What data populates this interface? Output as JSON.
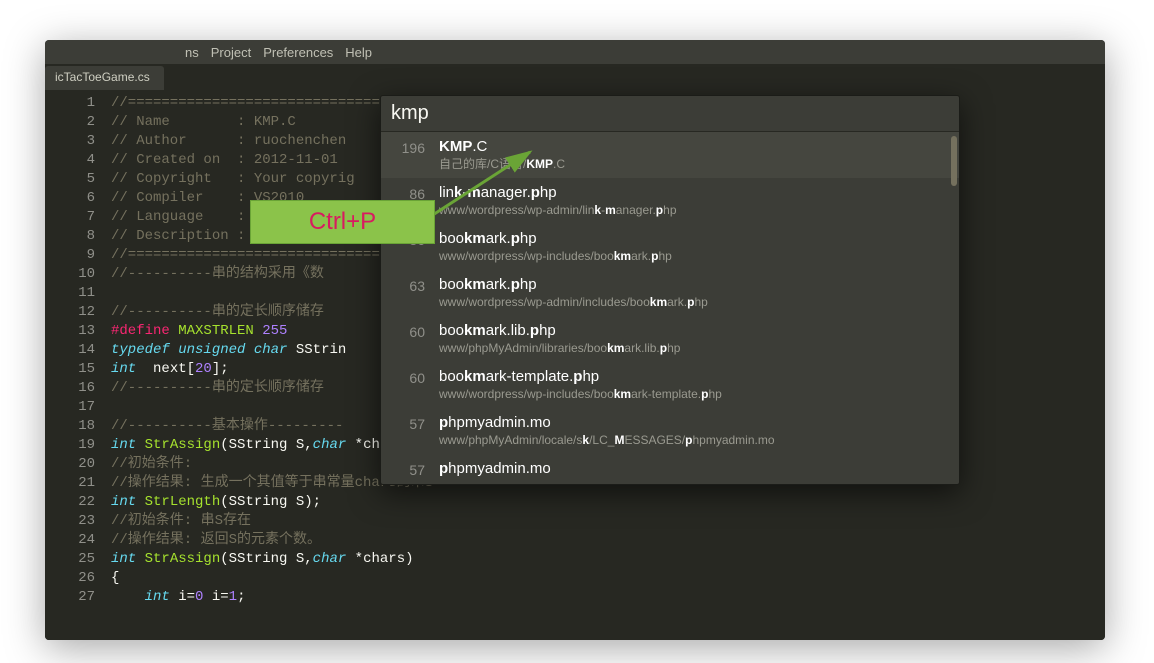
{
  "menubar": {
    "items": [
      "ns",
      "Project",
      "Preferences",
      "Help"
    ]
  },
  "tab": {
    "filename": "icTacToeGame.cs"
  },
  "code": {
    "lines": [
      {
        "n": 1,
        "cls": "c-comment",
        "text": "//========================================================================"
      },
      {
        "n": 2,
        "cls": "c-comment",
        "text": "// Name        : KMP.C"
      },
      {
        "n": 3,
        "cls": "c-comment",
        "text": "// Author      : ruochenchen"
      },
      {
        "n": 4,
        "cls": "c-comment",
        "text": "// Created on  : 2012-11-01"
      },
      {
        "n": 5,
        "cls": "c-comment",
        "text": "// Copyright   : Your copyrig"
      },
      {
        "n": 6,
        "cls": "c-comment",
        "text": "// Compiler    : VS2010"
      },
      {
        "n": 7,
        "cls": "c-comment",
        "text": "// Language    : C"
      },
      {
        "n": 8,
        "cls": "c-comment",
        "text": "// Description :"
      },
      {
        "n": 9,
        "cls": "c-comment",
        "text": "//========================================================================"
      },
      {
        "n": 10,
        "cls": "c-comment",
        "text": "//----------串的结构采用《数"
      },
      {
        "n": 11,
        "cls": "",
        "text": ""
      },
      {
        "n": 12,
        "cls": "c-comment",
        "text": "//----------串的定长顺序储存"
      },
      {
        "n": 13,
        "html": "<span class='c-define'>#define</span> <span class='c-macro'>MAXSTRLEN</span> <span class='c-num'>255</span>"
      },
      {
        "n": 14,
        "html": "<span class='c-storage'>typedef</span> <span class='c-storage'>unsigned</span> <span class='c-storage'>char</span> <span class='c-paren'>SStrin</span>"
      },
      {
        "n": 15,
        "html": "<span class='c-type'>int</span>  next[<span class='c-num'>20</span>];"
      },
      {
        "n": 16,
        "cls": "c-comment",
        "text": "//----------串的定长顺序储存"
      },
      {
        "n": 17,
        "cls": "",
        "text": ""
      },
      {
        "n": 18,
        "cls": "c-comment",
        "text": "//----------基本操作---------"
      },
      {
        "n": 19,
        "html": "<span class='c-type'>int</span> <span class='c-func'>StrAssign</span>(SString S,<span class='c-storage'>char</span> *chars);"
      },
      {
        "n": 20,
        "cls": "c-comment",
        "text": "//初始条件:"
      },
      {
        "n": 21,
        "cls": "c-comment",
        "text": "//操作结果: 生成一个其值等于串常量chars的串S"
      },
      {
        "n": 22,
        "html": "<span class='c-type'>int</span> <span class='c-func'>StrLength</span>(SString S);"
      },
      {
        "n": 23,
        "cls": "c-comment",
        "text": "//初始条件: 串S存在"
      },
      {
        "n": 24,
        "cls": "c-comment",
        "text": "//操作结果: 返回S的元素个数。"
      },
      {
        "n": 25,
        "html": "<span class='c-type'>int</span> <span class='c-func'>StrAssign</span>(SString S,<span class='c-storage'>char</span> *chars)"
      },
      {
        "n": 26,
        "cls": "",
        "text": "{"
      },
      {
        "n": 27,
        "html": "    <span class='c-type'>int</span> i=<span class='c-num'>0</span> i=<span class='c-num'>1</span>;"
      }
    ]
  },
  "palette": {
    "query": "kmp",
    "items": [
      {
        "idx": "196",
        "title": "<b>KMP</b>.C",
        "path": "自己的库/C语言/<b>KMP</b>.C",
        "selected": true
      },
      {
        "idx": "86",
        "title": "lin<b>k</b>-<b>m</b>anager.<b>p</b>hp",
        "path": "www/wordpress/wp-admin/lin<b>k</b>-<b>m</b>anager.<b>p</b>hp"
      },
      {
        "idx": "86",
        "title": "boo<b>km</b>ark.<b>p</b>hp",
        "path": "www/wordpress/wp-includes/boo<b>km</b>ark.<b>p</b>hp"
      },
      {
        "idx": "63",
        "title": "boo<b>km</b>ark.<b>p</b>hp",
        "path": "www/wordpress/wp-admin/includes/boo<b>km</b>ark.<b>p</b>hp"
      },
      {
        "idx": "60",
        "title": "boo<b>km</b>ark.lib.<b>p</b>hp",
        "path": "www/phpMyAdmin/libraries/boo<b>km</b>ark.lib.<b>p</b>hp"
      },
      {
        "idx": "60",
        "title": "boo<b>km</b>ark-template.<b>p</b>hp",
        "path": "www/wordpress/wp-includes/boo<b>km</b>ark-template.<b>p</b>hp"
      },
      {
        "idx": "57",
        "title": "<b>p</b>hpmyadmin.mo",
        "path": "www/phpMyAdmin/locale/s<b>k</b>/LC_<b>M</b>ESSAGES/<b>p</b>hpmyadmin.mo"
      },
      {
        "idx": "57",
        "title": "<b>p</b>hpmyadmin.mo",
        "path": ""
      }
    ]
  },
  "callout": {
    "label": "Ctrl+P"
  }
}
